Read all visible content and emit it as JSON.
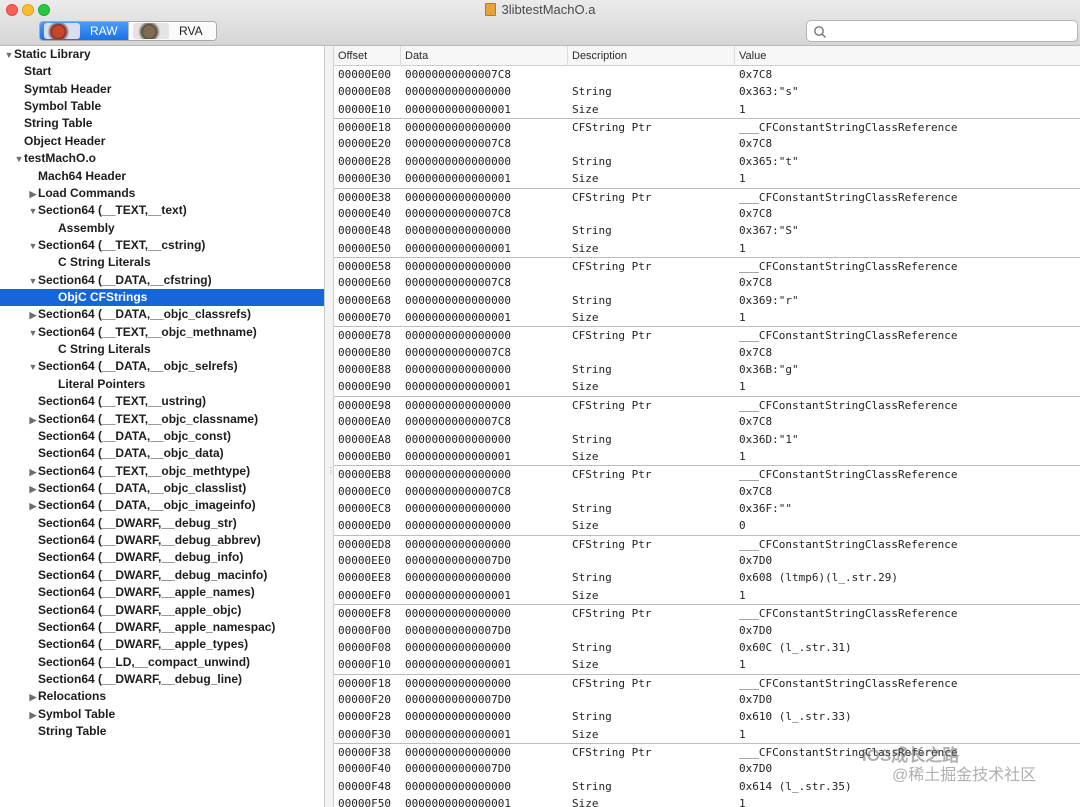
{
  "window": {
    "title": "3libtestMachO.a",
    "raw_label": "RAW",
    "rva_label": "RVA",
    "search_placeholder": ""
  },
  "sidebar": {
    "items": [
      {
        "label": "Static Library",
        "level": 0,
        "disclosure": "expanded"
      },
      {
        "label": "Start",
        "level": 1,
        "disclosure": "none"
      },
      {
        "label": "Symtab Header",
        "level": 1,
        "disclosure": "none"
      },
      {
        "label": "Symbol Table",
        "level": 1,
        "disclosure": "none"
      },
      {
        "label": "String Table",
        "level": 1,
        "disclosure": "none"
      },
      {
        "label": "Object Header",
        "level": 1,
        "disclosure": "none"
      },
      {
        "label": "testMachO.o",
        "level": 1,
        "disclosure": "expanded"
      },
      {
        "label": "Mach64 Header",
        "level": 2,
        "disclosure": "none"
      },
      {
        "label": "Load Commands",
        "level": 2,
        "disclosure": "collapsed"
      },
      {
        "label": "Section64 (__TEXT,__text)",
        "level": 2,
        "disclosure": "expanded"
      },
      {
        "label": "Assembly",
        "level": 3,
        "disclosure": "none"
      },
      {
        "label": "Section64 (__TEXT,__cstring)",
        "level": 2,
        "disclosure": "expanded"
      },
      {
        "label": "C String Literals",
        "level": 3,
        "disclosure": "none"
      },
      {
        "label": "Section64 (__DATA,__cfstring)",
        "level": 2,
        "disclosure": "expanded"
      },
      {
        "label": "ObjC CFStrings",
        "level": 3,
        "disclosure": "none",
        "selected": true
      },
      {
        "label": "Section64 (__DATA,__objc_classrefs)",
        "level": 2,
        "disclosure": "collapsed"
      },
      {
        "label": "Section64 (__TEXT,__objc_methname)",
        "level": 2,
        "disclosure": "expanded"
      },
      {
        "label": "C String Literals",
        "level": 3,
        "disclosure": "none"
      },
      {
        "label": "Section64 (__DATA,__objc_selrefs)",
        "level": 2,
        "disclosure": "expanded"
      },
      {
        "label": "Literal Pointers",
        "level": 3,
        "disclosure": "none"
      },
      {
        "label": "Section64 (__TEXT,__ustring)",
        "level": 2,
        "disclosure": "none"
      },
      {
        "label": "Section64 (__TEXT,__objc_classname)",
        "level": 2,
        "disclosure": "collapsed"
      },
      {
        "label": "Section64 (__DATA,__objc_const)",
        "level": 2,
        "disclosure": "none"
      },
      {
        "label": "Section64 (__DATA,__objc_data)",
        "level": 2,
        "disclosure": "none"
      },
      {
        "label": "Section64 (__TEXT,__objc_methtype)",
        "level": 2,
        "disclosure": "collapsed"
      },
      {
        "label": "Section64 (__DATA,__objc_classlist)",
        "level": 2,
        "disclosure": "collapsed"
      },
      {
        "label": "Section64 (__DATA,__objc_imageinfo)",
        "level": 2,
        "disclosure": "collapsed"
      },
      {
        "label": "Section64 (__DWARF,__debug_str)",
        "level": 2,
        "disclosure": "none"
      },
      {
        "label": "Section64 (__DWARF,__debug_abbrev)",
        "level": 2,
        "disclosure": "none"
      },
      {
        "label": "Section64 (__DWARF,__debug_info)",
        "level": 2,
        "disclosure": "none"
      },
      {
        "label": "Section64 (__DWARF,__debug_macinfo)",
        "level": 2,
        "disclosure": "none"
      },
      {
        "label": "Section64 (__DWARF,__apple_names)",
        "level": 2,
        "disclosure": "none"
      },
      {
        "label": "Section64 (__DWARF,__apple_objc)",
        "level": 2,
        "disclosure": "none"
      },
      {
        "label": "Section64 (__DWARF,__apple_namespac)",
        "level": 2,
        "disclosure": "none"
      },
      {
        "label": "Section64 (__DWARF,__apple_types)",
        "level": 2,
        "disclosure": "none"
      },
      {
        "label": "Section64 (__LD,__compact_unwind)",
        "level": 2,
        "disclosure": "none"
      },
      {
        "label": "Section64 (__DWARF,__debug_line)",
        "level": 2,
        "disclosure": "none"
      },
      {
        "label": "Relocations",
        "level": 2,
        "disclosure": "collapsed"
      },
      {
        "label": "Symbol Table",
        "level": 2,
        "disclosure": "collapsed"
      },
      {
        "label": "String Table",
        "level": 2,
        "disclosure": "none"
      }
    ]
  },
  "table": {
    "headers": {
      "offset": "Offset",
      "data": "Data",
      "description": "Description",
      "value": "Value"
    },
    "rows": [
      {
        "offset": "00000E00",
        "data": "00000000000007C8",
        "description": "",
        "value": "0x7C8",
        "group_start": false
      },
      {
        "offset": "00000E08",
        "data": "0000000000000000",
        "description": "String",
        "value": "0x363:\"s\"",
        "group_start": false
      },
      {
        "offset": "00000E10",
        "data": "0000000000000001",
        "description": "Size",
        "value": "1",
        "group_start": false
      },
      {
        "offset": "00000E18",
        "data": "0000000000000000",
        "description": "CFString Ptr",
        "value": "___CFConstantStringClassReference",
        "group_start": true
      },
      {
        "offset": "00000E20",
        "data": "00000000000007C8",
        "description": "",
        "value": "0x7C8",
        "group_start": false
      },
      {
        "offset": "00000E28",
        "data": "0000000000000000",
        "description": "String",
        "value": "0x365:\"t\"",
        "group_start": false
      },
      {
        "offset": "00000E30",
        "data": "0000000000000001",
        "description": "Size",
        "value": "1",
        "group_start": false
      },
      {
        "offset": "00000E38",
        "data": "0000000000000000",
        "description": "CFString Ptr",
        "value": "___CFConstantStringClassReference",
        "group_start": true
      },
      {
        "offset": "00000E40",
        "data": "00000000000007C8",
        "description": "",
        "value": "0x7C8",
        "group_start": false
      },
      {
        "offset": "00000E48",
        "data": "0000000000000000",
        "description": "String",
        "value": "0x367:\"S\"",
        "group_start": false
      },
      {
        "offset": "00000E50",
        "data": "0000000000000001",
        "description": "Size",
        "value": "1",
        "group_start": false
      },
      {
        "offset": "00000E58",
        "data": "0000000000000000",
        "description": "CFString Ptr",
        "value": "___CFConstantStringClassReference",
        "group_start": true
      },
      {
        "offset": "00000E60",
        "data": "00000000000007C8",
        "description": "",
        "value": "0x7C8",
        "group_start": false
      },
      {
        "offset": "00000E68",
        "data": "0000000000000000",
        "description": "String",
        "value": "0x369:\"r\"",
        "group_start": false
      },
      {
        "offset": "00000E70",
        "data": "0000000000000001",
        "description": "Size",
        "value": "1",
        "group_start": false
      },
      {
        "offset": "00000E78",
        "data": "0000000000000000",
        "description": "CFString Ptr",
        "value": "___CFConstantStringClassReference",
        "group_start": true
      },
      {
        "offset": "00000E80",
        "data": "00000000000007C8",
        "description": "",
        "value": "0x7C8",
        "group_start": false
      },
      {
        "offset": "00000E88",
        "data": "0000000000000000",
        "description": "String",
        "value": "0x36B:\"g\"",
        "group_start": false
      },
      {
        "offset": "00000E90",
        "data": "0000000000000001",
        "description": "Size",
        "value": "1",
        "group_start": false
      },
      {
        "offset": "00000E98",
        "data": "0000000000000000",
        "description": "CFString Ptr",
        "value": "___CFConstantStringClassReference",
        "group_start": true
      },
      {
        "offset": "00000EA0",
        "data": "00000000000007C8",
        "description": "",
        "value": "0x7C8",
        "group_start": false
      },
      {
        "offset": "00000EA8",
        "data": "0000000000000000",
        "description": "String",
        "value": "0x36D:\"1\"",
        "group_start": false
      },
      {
        "offset": "00000EB0",
        "data": "0000000000000001",
        "description": "Size",
        "value": "1",
        "group_start": false
      },
      {
        "offset": "00000EB8",
        "data": "0000000000000000",
        "description": "CFString Ptr",
        "value": "___CFConstantStringClassReference",
        "group_start": true
      },
      {
        "offset": "00000EC0",
        "data": "00000000000007C8",
        "description": "",
        "value": "0x7C8",
        "group_start": false
      },
      {
        "offset": "00000EC8",
        "data": "0000000000000000",
        "description": "String",
        "value": "0x36F:\"\"",
        "group_start": false
      },
      {
        "offset": "00000ED0",
        "data": "0000000000000000",
        "description": "Size",
        "value": "0",
        "group_start": false
      },
      {
        "offset": "00000ED8",
        "data": "0000000000000000",
        "description": "CFString Ptr",
        "value": "___CFConstantStringClassReference",
        "group_start": true
      },
      {
        "offset": "00000EE0",
        "data": "00000000000007D0",
        "description": "",
        "value": "0x7D0",
        "group_start": false
      },
      {
        "offset": "00000EE8",
        "data": "0000000000000000",
        "description": "String",
        "value": "0x608 (ltmp6)(l_.str.29)",
        "group_start": false
      },
      {
        "offset": "00000EF0",
        "data": "0000000000000001",
        "description": "Size",
        "value": "1",
        "group_start": false
      },
      {
        "offset": "00000EF8",
        "data": "0000000000000000",
        "description": "CFString Ptr",
        "value": "___CFConstantStringClassReference",
        "group_start": true
      },
      {
        "offset": "00000F00",
        "data": "00000000000007D0",
        "description": "",
        "value": "0x7D0",
        "group_start": false
      },
      {
        "offset": "00000F08",
        "data": "0000000000000000",
        "description": "String",
        "value": "0x60C (l_.str.31)",
        "group_start": false
      },
      {
        "offset": "00000F10",
        "data": "0000000000000001",
        "description": "Size",
        "value": "1",
        "group_start": false
      },
      {
        "offset": "00000F18",
        "data": "0000000000000000",
        "description": "CFString Ptr",
        "value": "___CFConstantStringClassReference",
        "group_start": true
      },
      {
        "offset": "00000F20",
        "data": "00000000000007D0",
        "description": "",
        "value": "0x7D0",
        "group_start": false
      },
      {
        "offset": "00000F28",
        "data": "0000000000000000",
        "description": "String",
        "value": "0x610 (l_.str.33)",
        "group_start": false
      },
      {
        "offset": "00000F30",
        "data": "0000000000000001",
        "description": "Size",
        "value": "1",
        "group_start": false
      },
      {
        "offset": "00000F38",
        "data": "0000000000000000",
        "description": "CFString Ptr",
        "value": "___CFConstantStringClassReference",
        "group_start": true
      },
      {
        "offset": "00000F40",
        "data": "00000000000007D0",
        "description": "",
        "value": "0x7D0",
        "group_start": false
      },
      {
        "offset": "00000F48",
        "data": "0000000000000000",
        "description": "String",
        "value": "0x614 (l_.str.35)",
        "group_start": false
      },
      {
        "offset": "00000F50",
        "data": "0000000000000001",
        "description": "Size",
        "value": "1",
        "group_start": false
      }
    ]
  },
  "watermark": {
    "line1": "iOS成长之路",
    "line2": "@稀土掘金技术社区"
  },
  "colors": {
    "selection": "#1566d8",
    "segment_active": "#1c6fe8"
  }
}
